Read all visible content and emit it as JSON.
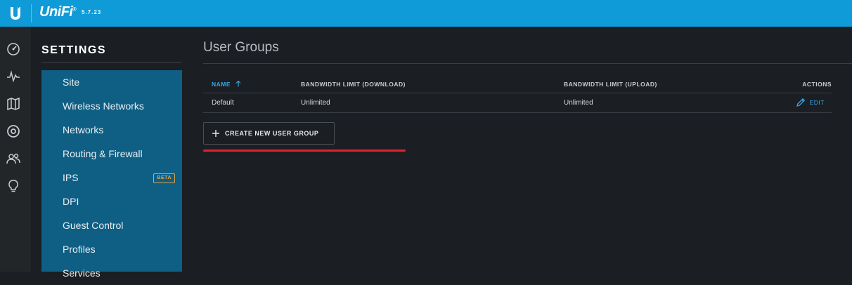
{
  "app": {
    "brand": "UniFi",
    "version": "5.7.23",
    "accent": "#0f9bd7"
  },
  "rail": {
    "icons": [
      "dashboard-icon",
      "statistics-icon",
      "map-icon",
      "devices-icon",
      "clients-icon",
      "insights-icon"
    ]
  },
  "settings": {
    "title": "SETTINGS",
    "menu": [
      {
        "label": "Site"
      },
      {
        "label": "Wireless Networks"
      },
      {
        "label": "Networks"
      },
      {
        "label": "Routing & Firewall"
      },
      {
        "label": "IPS",
        "badge": "BETA"
      },
      {
        "label": "DPI"
      },
      {
        "label": "Guest Control"
      },
      {
        "label": "Profiles"
      },
      {
        "label": "Services"
      }
    ]
  },
  "main": {
    "title": "User Groups",
    "table": {
      "columns": {
        "name": "NAME",
        "download": "BANDWIDTH LIMIT (DOWNLOAD)",
        "upload": "BANDWIDTH LIMIT (UPLOAD)",
        "actions": "ACTIONS"
      },
      "rows": [
        {
          "name": "Default",
          "download": "Unlimited",
          "upload": "Unlimited",
          "action": "EDIT"
        }
      ]
    },
    "create_button": "CREATE NEW USER GROUP"
  }
}
